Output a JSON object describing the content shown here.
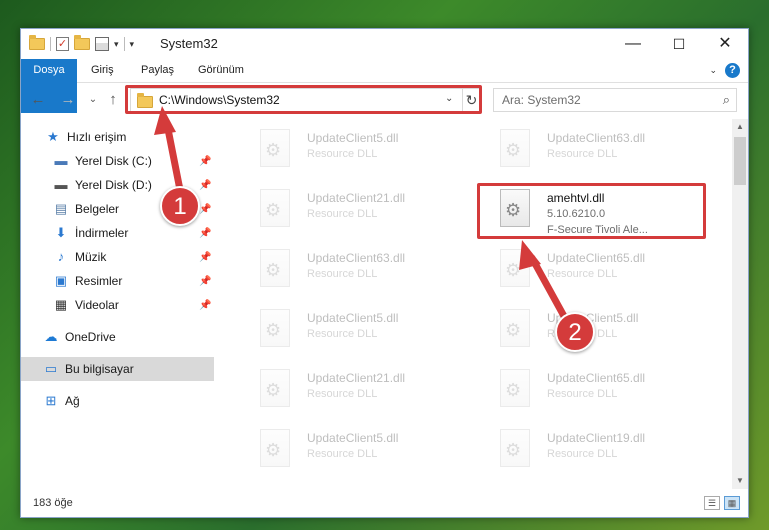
{
  "window": {
    "title": "System32"
  },
  "ribbon": {
    "tabs": [
      "Dosya",
      "Giriş",
      "Paylaş",
      "Görünüm"
    ]
  },
  "window_controls": {
    "minimize": "—",
    "maximize": "☐",
    "close": "✕"
  },
  "address": {
    "path": "C:\\Windows\\System32",
    "dropdown": "⌄",
    "refresh": "↻"
  },
  "search": {
    "placeholder": "Ara: System32"
  },
  "nav": {
    "back": "←",
    "forward": "→",
    "recent": "⌄",
    "up": "↑"
  },
  "sidebar": {
    "items": [
      {
        "label": "Hızlı erişim",
        "icon": "star-icon",
        "pinned": false
      },
      {
        "label": "Yerel Disk (C:)",
        "icon": "drive-icon",
        "pinned": true
      },
      {
        "label": "Yerel Disk (D:)",
        "icon": "drive-icon",
        "pinned": true
      },
      {
        "label": "Belgeler",
        "icon": "documents-icon",
        "pinned": true
      },
      {
        "label": "İndirmeler",
        "icon": "downloads-icon",
        "pinned": true
      },
      {
        "label": "Müzik",
        "icon": "music-icon",
        "pinned": true
      },
      {
        "label": "Resimler",
        "icon": "pictures-icon",
        "pinned": true
      },
      {
        "label": "Videolar",
        "icon": "videos-icon",
        "pinned": true
      },
      {
        "label": "OneDrive",
        "icon": "cloud-icon",
        "pinned": false
      },
      {
        "label": "Bu bilgisayar",
        "icon": "computer-icon",
        "pinned": false
      },
      {
        "label": "Ağ",
        "icon": "network-icon",
        "pinned": false
      }
    ]
  },
  "files": {
    "left": [
      {
        "name": "UpdateClient5.dll",
        "type": "Resource DLL"
      },
      {
        "name": "UpdateClient21.dll",
        "type": "Resource DLL"
      },
      {
        "name": "UpdateClient63.dll",
        "type": "Resource DLL"
      },
      {
        "name": "UpdateClient5.dll",
        "type": "Resource DLL"
      },
      {
        "name": "UpdateClient21.dll",
        "type": "Resource DLL"
      },
      {
        "name": "UpdateClient5.dll",
        "type": "Resource DLL"
      }
    ],
    "right": [
      {
        "name": "UpdateClient63.dll",
        "type": "Resource DLL"
      },
      {
        "name": "amehtvl.dll",
        "version": "5.10.6210.0",
        "type": "F-Secure Tivoli Ale..."
      },
      {
        "name": "UpdateClient65.dll",
        "type": "Resource DLL"
      },
      {
        "name": "UpdateClient5.dll",
        "type": "Resource DLL"
      },
      {
        "name": "UpdateClient65.dll",
        "type": "Resource DLL"
      },
      {
        "name": "UpdateClient19.dll",
        "type": "Resource DLL"
      }
    ]
  },
  "status": {
    "count": "183 öğe"
  },
  "annotations": {
    "step1": "1",
    "step2": "2",
    "color": "#d43b3b"
  }
}
